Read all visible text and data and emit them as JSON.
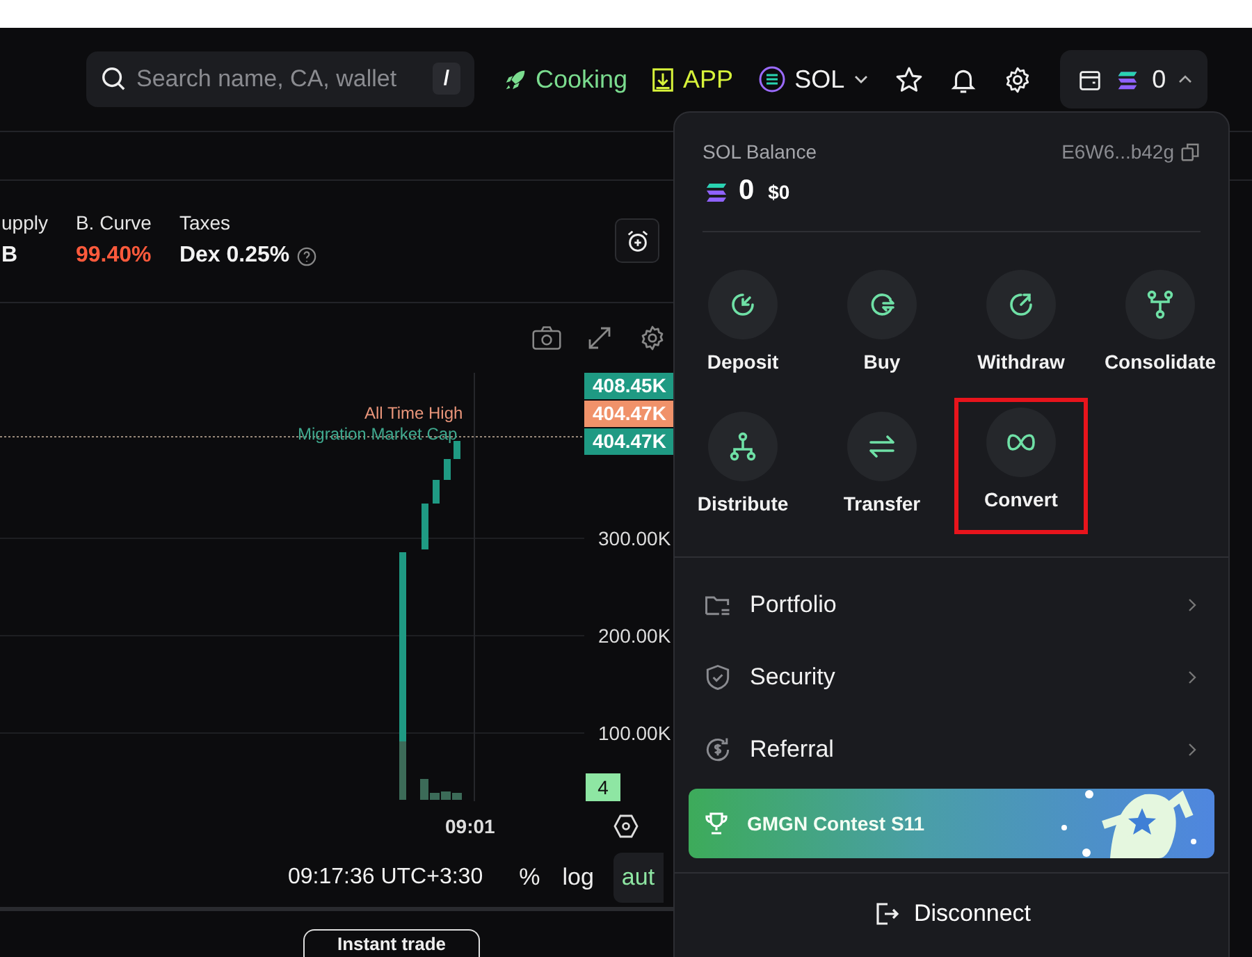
{
  "search": {
    "placeholder": "Search name, CA, wallet",
    "shortcut": "/"
  },
  "nav": {
    "cooking": "Cooking",
    "app": "APP",
    "chain": "SOL"
  },
  "wallet_button": {
    "balance": "0",
    "expanded": true
  },
  "stats": [
    {
      "label": "upply",
      "value": "B",
      "kind": "plain"
    },
    {
      "label": "B. Curve",
      "value": "99.40%",
      "kind": "danger"
    },
    {
      "label": "Taxes",
      "value": "Dex 0.25%",
      "kind": "info"
    }
  ],
  "chart": {
    "price_tags": [
      {
        "text": "408.45K",
        "color": "#1f9a83"
      },
      {
        "text": "404.47K",
        "color": "#f0926a"
      },
      {
        "text": "404.47K",
        "color": "#1f9a83"
      }
    ],
    "axis_labels": [
      "300.00K",
      "200.00K",
      "100.00K"
    ],
    "volume_tag": "4",
    "markers": [
      "All Time High",
      "Migration Market Cap"
    ],
    "time_label": "09:01"
  },
  "footer": {
    "clock": "09:17:36 UTC+3:30",
    "percent": "%",
    "log": "log",
    "auto": "aut"
  },
  "bottom": {
    "instant_trade": "Instant trade"
  },
  "popup": {
    "title": "SOL Balance",
    "address": "E6W6...b42g",
    "amount": "0",
    "usd": "$0",
    "actions": [
      {
        "label": "Deposit",
        "kind": "deposit",
        "highlighted": false
      },
      {
        "label": "Buy",
        "kind": "buy",
        "highlighted": false
      },
      {
        "label": "Withdraw",
        "kind": "withdraw",
        "highlighted": false
      },
      {
        "label": "Consolidate",
        "kind": "consolidate",
        "highlighted": false
      },
      {
        "label": "Distribute",
        "kind": "distribute",
        "highlighted": false
      },
      {
        "label": "Transfer",
        "kind": "transfer",
        "highlighted": false
      },
      {
        "label": "Convert",
        "kind": "convert",
        "highlighted": true
      }
    ],
    "links": [
      {
        "label": "Portfolio",
        "kind": "portfolio"
      },
      {
        "label": "Security",
        "kind": "security"
      },
      {
        "label": "Referral",
        "kind": "referral"
      }
    ],
    "banner": "GMGN Contest S11",
    "disconnect": "Disconnect"
  }
}
